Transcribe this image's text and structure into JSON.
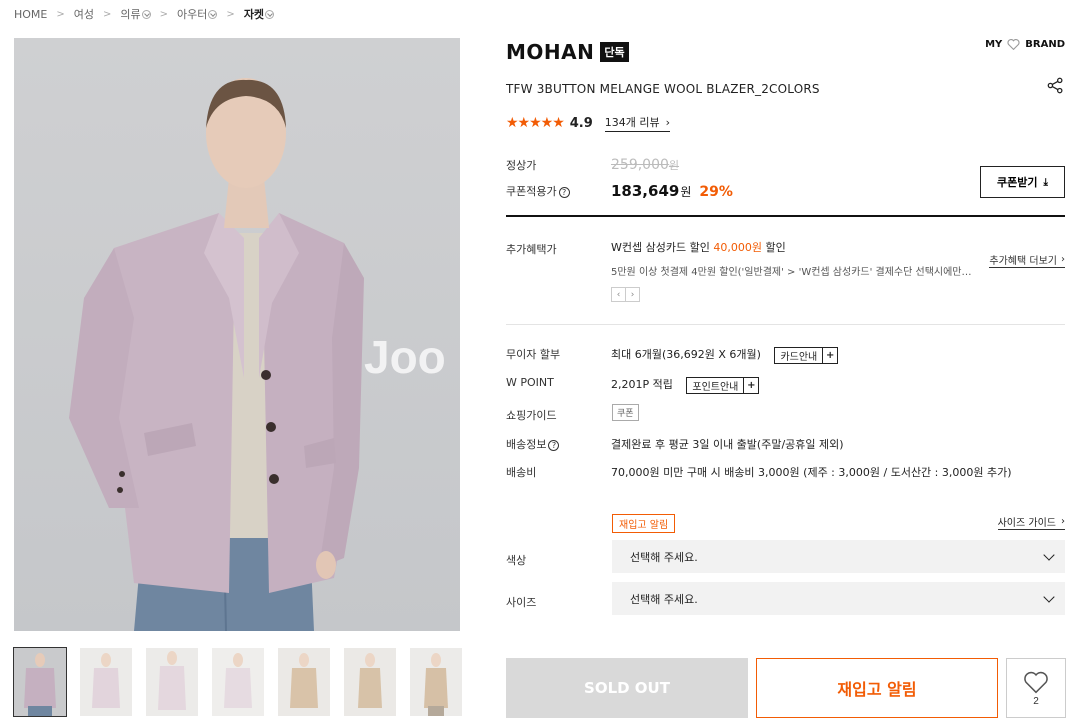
{
  "breadcrumb": [
    {
      "label": "HOME",
      "dropdown": false
    },
    {
      "label": "여성",
      "dropdown": false
    },
    {
      "label": "의류",
      "dropdown": true
    },
    {
      "label": "아우터",
      "dropdown": true
    },
    {
      "label": "자켓",
      "dropdown": true
    }
  ],
  "gallery": {
    "watermark": "Joo",
    "thumbnails": 7
  },
  "brand": {
    "name": "MOHAN",
    "badge": "단독",
    "my_label": "MY",
    "brand_label": "BRAND",
    "heart_icon": "heart-outline-icon"
  },
  "product": {
    "name": "TFW 3BUTTON MELANGE WOOL BLAZER_2COLORS",
    "share_icon": "share-icon"
  },
  "rating": {
    "stars": "★★★★★",
    "value": "4.9",
    "reviews_label": "134개 리뷰",
    "chevron": "›"
  },
  "price": {
    "regular_label": "정상가",
    "regular_value": "259,000",
    "regular_unit": "원",
    "coupon_label": "쿠폰적용가",
    "help_mark": "?",
    "sale_value": "183,649",
    "sale_unit": "원",
    "discount": "29%",
    "coupon_button": "쿠폰받기",
    "download_icon": "⤓"
  },
  "benefits": {
    "label": "추가혜택가",
    "card_text": "W컨셉 삼성카드 ",
    "discount_word": "할인 ",
    "discount_amount": "40,000원",
    "discount_suffix": " 할인",
    "description": "5만원 이상 첫결제 4만원 할인('일반결제' > 'W컨셉 삼성카드' 결제수단 선택시에만 적용)",
    "more_label": "추가혜택 더보기",
    "chevron": "›",
    "prev": "‹",
    "next": "›"
  },
  "info_rows": {
    "installment_label": "무이자 할부",
    "installment_value": "최대 6개월(36,692원 X 6개월)",
    "installment_btn": "카드안내",
    "wpoint_label": "W POINT",
    "wpoint_value": "2,201P 적립",
    "wpoint_btn": "포인트안내",
    "plus": "+",
    "guide_label": "쇼핑가이드",
    "guide_tag": "쿠폰",
    "shipping_info_label": "배송정보",
    "shipping_info_value": "결제완료 후 평균 3일 이내 출발(주말/공휴일 제외)",
    "shipping_fee_label": "배송비",
    "shipping_fee_value": "70,000원 미만 구매 시 배송비 3,000원 (제주 : 3,000원 / 도서산간 : 3,000원 추가)"
  },
  "options": {
    "restock_tag": "재입고 알림",
    "size_guide": "사이즈 가이드",
    "chevron": "›",
    "color_label": "색상",
    "color_value": "선택해 주세요.",
    "size_label": "사이즈",
    "size_value": "선택해 주세요."
  },
  "actions": {
    "soldout": "SOLD OUT",
    "restock": "재입고 알림",
    "wish_count": "2"
  },
  "colors": {
    "accent": "#f25c05",
    "black": "#111111",
    "disabled": "#d9d9d9"
  }
}
